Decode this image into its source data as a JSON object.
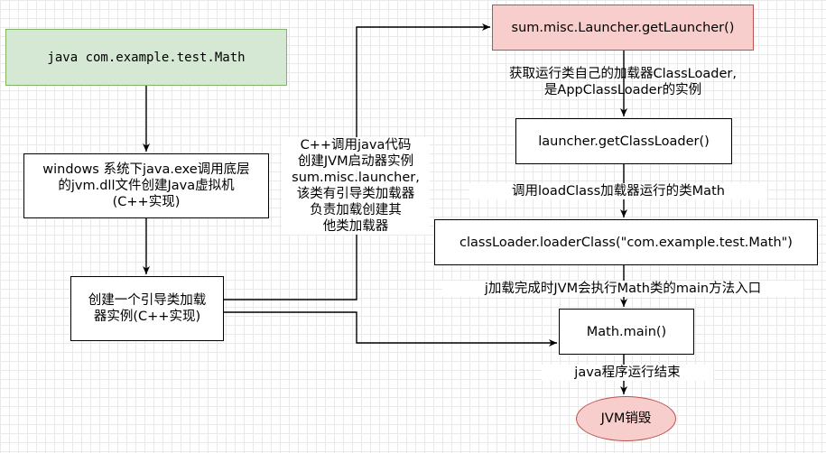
{
  "nodes": {
    "start": "java com.example.test.Math",
    "jvm": "windows 系统下java.exe调用底层\n的jvm.dll文件创建Java虚拟机\n(C++实现)",
    "bootstrap": "创建一个引导类加载\n器实例(C++实现)",
    "launcher": "sum.misc.Launcher.getLauncher()",
    "get_class_loader": "launcher.getClassLoader()",
    "load_class": "classLoader.loaderClass(\"com.example.test.Math\")",
    "main": "Math.main()",
    "destroy": "JVM销毁"
  },
  "edge_labels": {
    "cpp_call": "C++调用java代码\n创建JVM启动器实例\nsum.misc.launcher,\n该类有引导类加载器\n负责加载创建其\n他类加载器",
    "get_launcher": "获取运行类自己的加载器ClassLoader,\n是AppClassLoader的实例",
    "load_class": "调用loadClass加载器运行的类Math",
    "loaded": "j加载完成时JVM会执行Math类的main方法入口",
    "end": "java程序运行结束"
  },
  "colors": {
    "start_fill": "#d5e8d4",
    "start_stroke": "#82b366",
    "launcher_fill": "#f8cecc",
    "launcher_stroke": "#b85450",
    "destroy_fill": "#f8cecc",
    "destroy_stroke": "#b85450"
  }
}
